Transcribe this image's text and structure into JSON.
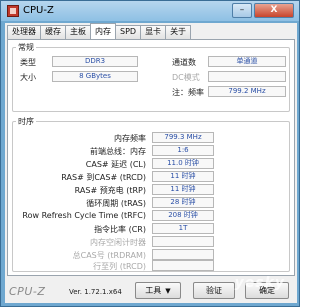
{
  "window": {
    "title": "CPU-Z",
    "minimize_glyph": "–",
    "close_glyph": "X"
  },
  "tabs": [
    {
      "label": "处理器",
      "active": false
    },
    {
      "label": "缓存",
      "active": false
    },
    {
      "label": "主板",
      "active": false
    },
    {
      "label": "内存",
      "active": true
    },
    {
      "label": "SPD",
      "active": false
    },
    {
      "label": "显卡",
      "active": false
    },
    {
      "label": "关于",
      "active": false
    }
  ],
  "general": {
    "legend": "常规",
    "type_label": "类型",
    "type_value": "DDR3",
    "size_label": "大小",
    "size_value": "8 GBytes",
    "channel_label": "通道数",
    "channel_value": "单通道",
    "dc_mode_label": "DC模式",
    "dc_mode_value": "",
    "nb_freq_label": "注：频率",
    "nb_freq_value": "799.2 MHz"
  },
  "timings": {
    "legend": "时序",
    "rows": [
      {
        "label": "内存频率",
        "value": "799.3 MHz",
        "dim": false
      },
      {
        "label": "前端总线：内存",
        "value": "1:6",
        "dim": false
      },
      {
        "label": "CAS# 延迟 (CL)",
        "value": "11.0 时钟",
        "dim": false
      },
      {
        "label": "RAS# 到CAS# (tRCD)",
        "value": "11 时钟",
        "dim": false
      },
      {
        "label": "RAS# 预充电 (tRP)",
        "value": "11 时钟",
        "dim": false
      },
      {
        "label": "循环周期 (tRAS)",
        "value": "28 时钟",
        "dim": false
      },
      {
        "label": "Row Refresh Cycle Time (tRFC)",
        "value": "208 时钟",
        "dim": false
      },
      {
        "label": "指令比率 (CR)",
        "value": "1T",
        "dim": false
      },
      {
        "label": "内存空闲计时器",
        "value": "",
        "dim": true
      },
      {
        "label": "总CAS号 (tRDRAM)",
        "value": "",
        "dim": true
      },
      {
        "label": "行至列 (tRCD)",
        "value": "",
        "dim": true
      }
    ]
  },
  "footer": {
    "brand": "CPU-Z",
    "version": "Ver. 1.72.1.x64",
    "tools_label": "工具",
    "validate_label": "验证",
    "confirm_label": "确定"
  },
  "watermark": "yesky"
}
